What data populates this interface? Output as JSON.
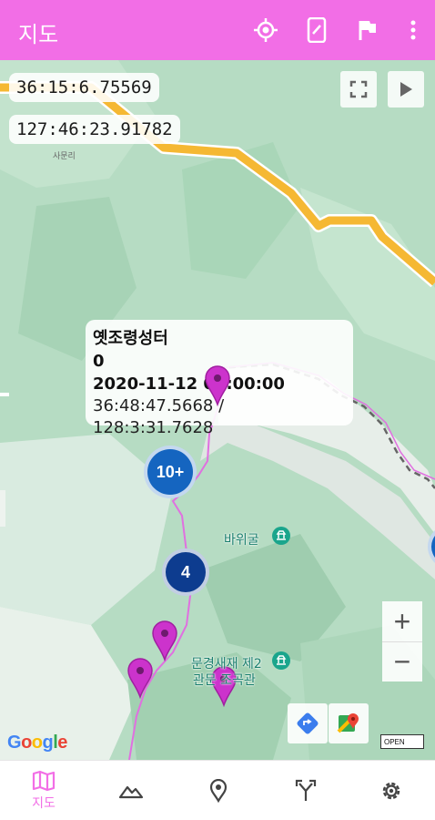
{
  "appbar": {
    "title": "지도",
    "icons": [
      "my-location-icon",
      "phone-icon",
      "flag-icon",
      "more-vert-icon"
    ]
  },
  "map": {
    "latitude_text": "36:15:6.75569",
    "longitude_text": "127:46:23.91782",
    "small_place_label": "사문리",
    "info_window": {
      "title": "옛조령성터",
      "line2": "0",
      "line3": "2020-11-12 09:00:00",
      "line4": "36:48:47.5668 / 128:3:31.7628"
    },
    "clusters": [
      {
        "label": "10+"
      },
      {
        "label": "4"
      }
    ],
    "poi_labels": {
      "rock_cave": "바위굴",
      "museum_line1": "문경새재 제2",
      "museum_line2": "관문 조곡관"
    },
    "zoom_in_label": "+",
    "zoom_out_label": "−",
    "google_logo": [
      "G",
      "o",
      "o",
      "g",
      "l",
      "e"
    ],
    "osm_label": "OPEN"
  },
  "bottom_nav": {
    "items": [
      {
        "label": "지도",
        "icon": "map-icon",
        "active": true
      },
      {
        "label": "",
        "icon": "mountain-icon",
        "active": false
      },
      {
        "label": "",
        "icon": "place-pin-icon",
        "active": false
      },
      {
        "label": "",
        "icon": "route-fork-icon",
        "active": false
      },
      {
        "label": "",
        "icon": "settings-icon",
        "active": false
      }
    ]
  },
  "colors": {
    "accent": "#f26ee6",
    "marker": "#cc33cc",
    "cluster": "#1565c0",
    "road": "#f5b833"
  }
}
